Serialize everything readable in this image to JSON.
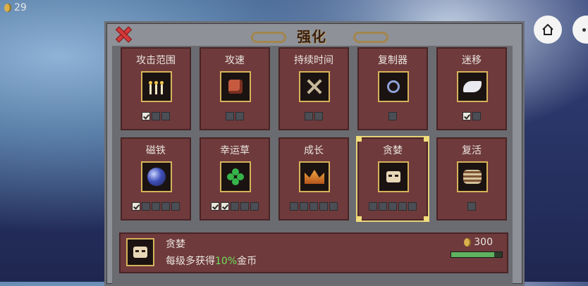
{
  "hud": {
    "coins": "29"
  },
  "panel": {
    "title": "强化",
    "row1": [
      {
        "name": "攻击范围",
        "icon": "candelabra-icon",
        "slots": [
          true,
          false,
          false
        ]
      },
      {
        "name": "攻速",
        "icon": "gauntlet-icon",
        "slots": [
          false,
          false
        ]
      },
      {
        "name": "持续时间",
        "icon": "crossed-bones-icon",
        "slots": [
          false,
          false
        ]
      },
      {
        "name": "复制器",
        "icon": "ring-icon",
        "slots": [
          false
        ]
      },
      {
        "name": "迷移",
        "icon": "wing-icon",
        "slots": [
          true,
          false
        ]
      }
    ],
    "row2": [
      {
        "name": "磁铁",
        "icon": "magnet-orb-icon",
        "slots": [
          true,
          false,
          false,
          false,
          false
        ]
      },
      {
        "name": "幸运草",
        "icon": "clover-icon",
        "slots": [
          true,
          true,
          false,
          false,
          false
        ]
      },
      {
        "name": "成长",
        "icon": "crown-icon",
        "slots": [
          false,
          false,
          false,
          false,
          false
        ]
      },
      {
        "name": "贪婪",
        "icon": "mask-icon",
        "slots": [
          false,
          false,
          false,
          false,
          false
        ],
        "selected": true
      },
      {
        "name": "复活",
        "icon": "nest-icon",
        "slots": [
          false
        ]
      }
    ],
    "info": {
      "name": "贪婪",
      "desc_prefix": "每级多获得",
      "desc_highlight": "10%",
      "desc_suffix": "金币",
      "cost": "300",
      "progress": 0.85
    }
  }
}
